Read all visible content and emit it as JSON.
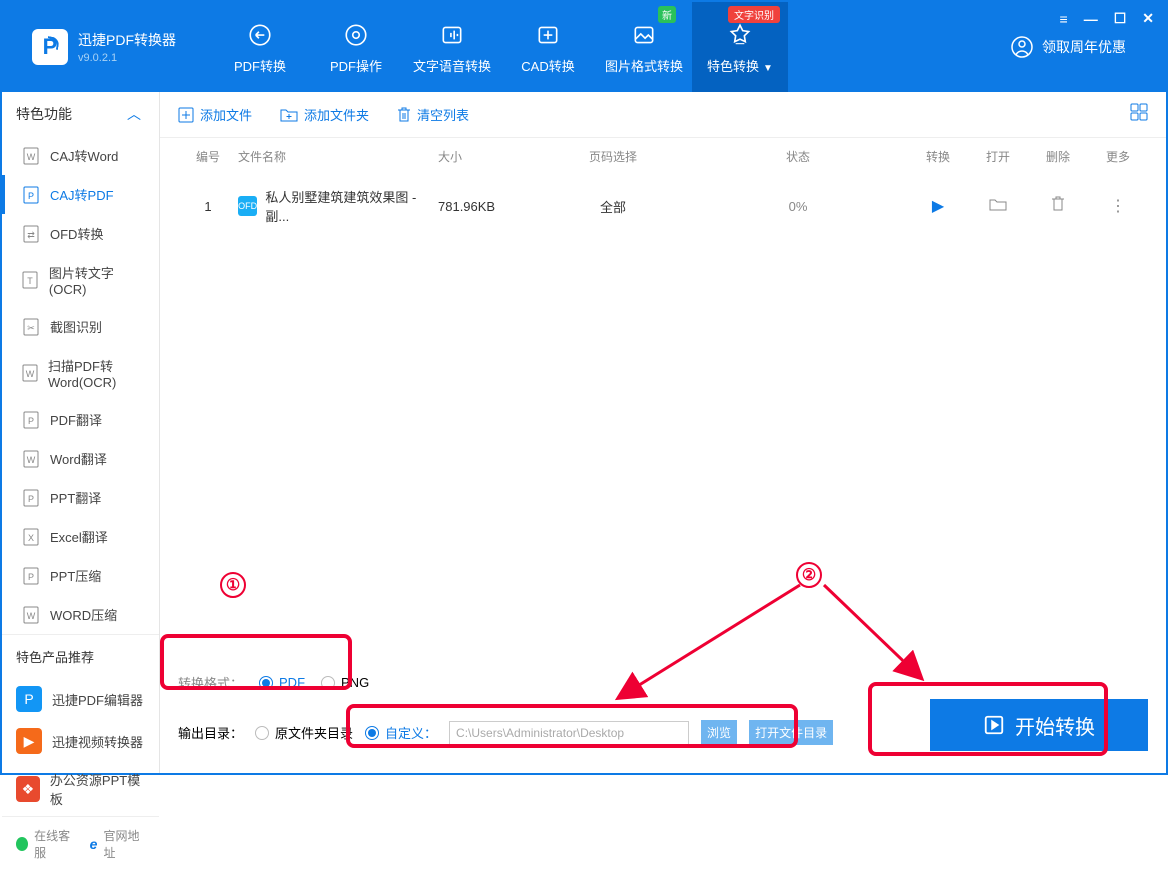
{
  "app": {
    "name": "迅捷PDF转换器",
    "version": "v9.0.2.1"
  },
  "topTabs": [
    {
      "label": "PDF转换"
    },
    {
      "label": "PDF操作"
    },
    {
      "label": "文字语音转换"
    },
    {
      "label": "CAD转换"
    },
    {
      "label": "图片格式转换",
      "badge": "新",
      "badgeClass": ""
    },
    {
      "label": "特色转换",
      "badge": "文字识别",
      "badgeClass": "red",
      "active": true,
      "dropdown": true
    }
  ],
  "promo": "领取周年优惠",
  "sidebar": {
    "header": "特色功能",
    "items": [
      {
        "label": "CAJ转Word"
      },
      {
        "label": "CAJ转PDF",
        "selected": true
      },
      {
        "label": "OFD转换"
      },
      {
        "label": "图片转文字(OCR)"
      },
      {
        "label": "截图识别"
      },
      {
        "label": "扫描PDF转Word(OCR)"
      },
      {
        "label": "PDF翻译"
      },
      {
        "label": "Word翻译"
      },
      {
        "label": "PPT翻译"
      },
      {
        "label": "Excel翻译"
      },
      {
        "label": "PPT压缩"
      },
      {
        "label": "WORD压缩"
      }
    ],
    "recoHeader": "特色产品推荐",
    "reco": [
      {
        "label": "迅捷PDF编辑器",
        "color": "#1296f5",
        "glyph": "P"
      },
      {
        "label": "迅捷视频转换器",
        "color": "#f56a1a",
        "glyph": "▶"
      },
      {
        "label": "办公资源PPT模板",
        "color": "#e84a2e",
        "glyph": "❖"
      }
    ],
    "footer": {
      "cs": "在线客服",
      "site": "官网地址"
    }
  },
  "toolbar": {
    "addFile": "添加文件",
    "addFolder": "添加文件夹",
    "clear": "清空列表"
  },
  "table": {
    "headers": {
      "idx": "编号",
      "name": "文件名称",
      "size": "大小",
      "page": "页码选择",
      "status": "状态",
      "conv": "转换",
      "open": "打开",
      "del": "删除",
      "more": "更多"
    },
    "rows": [
      {
        "idx": "1",
        "iconText": "OFD",
        "name": "私人别墅建筑建筑效果图 - 副...",
        "size": "781.96KB",
        "page": "全部",
        "status": "0%"
      }
    ]
  },
  "format": {
    "label": "转换格式：",
    "opt1": "PDF",
    "opt2": "PNG"
  },
  "output": {
    "label": "输出目录：",
    "opt1": "原文件夹目录",
    "opt2": "自定义：",
    "path": "C:\\Users\\Administrator\\Desktop",
    "browse": "浏览",
    "openDir": "打开文件目录"
  },
  "start": "开始转换",
  "anno": {
    "n1": "①",
    "n2": "②"
  }
}
